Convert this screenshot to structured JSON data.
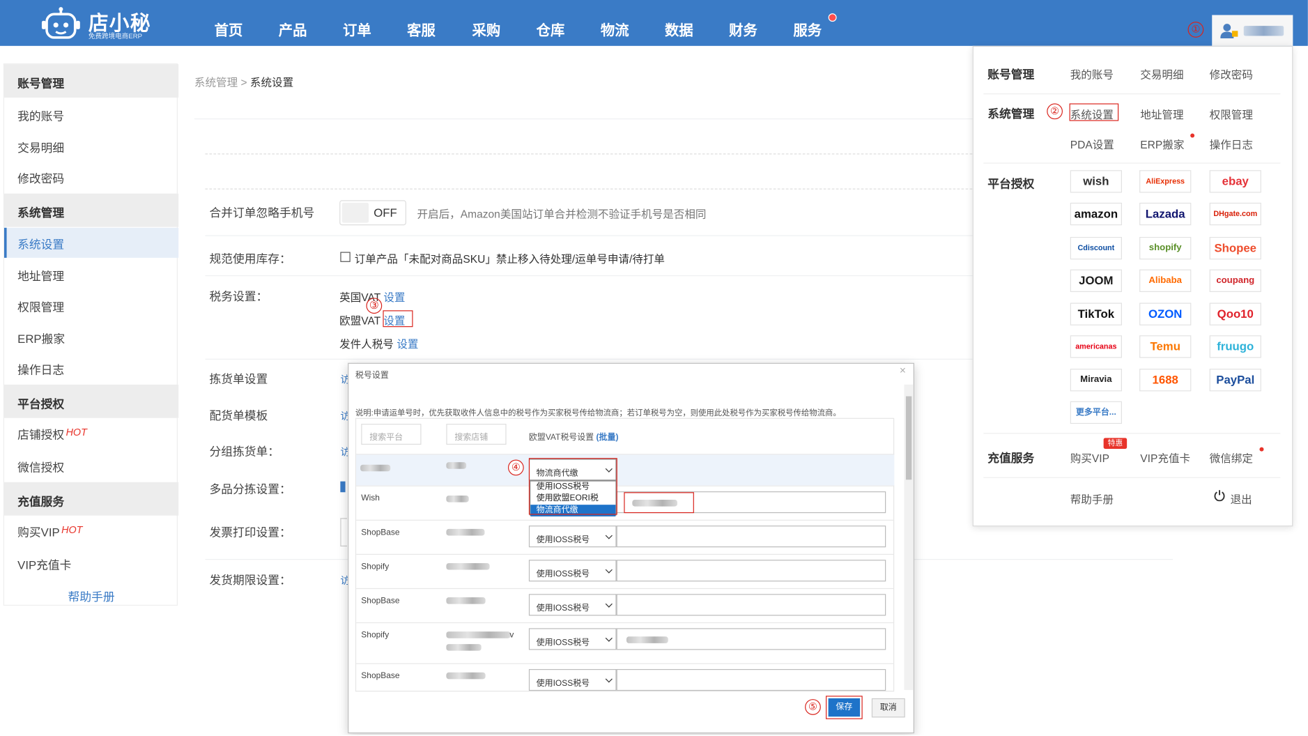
{
  "app": {
    "name": "店小秘",
    "tagline": "免费跨境电商ERP"
  },
  "nav": {
    "items": [
      "首页",
      "产品",
      "订单",
      "客服",
      "采购",
      "仓库",
      "物流",
      "数据",
      "财务",
      "服务"
    ]
  },
  "steps": [
    "①",
    "②",
    "③",
    "④",
    "⑤"
  ],
  "sidebar": {
    "sections": [
      {
        "title": "账号管理",
        "items": [
          "我的账号",
          "交易明细",
          "修改密码"
        ]
      },
      {
        "title": "系统管理",
        "items": [
          "系统设置",
          "地址管理",
          "权限管理",
          "ERP搬家",
          "操作日志"
        ]
      },
      {
        "title": "平台授权",
        "items": [
          "店铺授权",
          "微信授权"
        ]
      },
      {
        "title": "充值服务",
        "items": [
          "购买VIP",
          "VIP充值卡"
        ]
      }
    ],
    "hot": "HOT",
    "help": "帮助手册"
  },
  "breadcrumb": {
    "parent": "系统管理",
    "sep": ">",
    "current": "系统设置"
  },
  "settings": {
    "merge_label": "合并订单忽略手机号",
    "toggle": "OFF",
    "merge_hint": "开启后，Amazon美国站订单合并检测不验证手机号是否相同",
    "stock_label": "规范使用库存：",
    "stock_option": "订单产品「未配对商品SKU」禁止移入待处理/运单号申请/待打单",
    "tax_label": "税务设置：",
    "tax_uk": "英国VAT",
    "tax_eu": "欧盟VAT",
    "tax_sender": "发件人税号",
    "set_link": "设置",
    "picking_label": "拣货单设置",
    "packing_label": "配货单模板",
    "group_label": "分组拣货单：",
    "multi_label": "多品分拣设置：",
    "invoice_label": "发票打印设置：",
    "ship_deadline_label": "发货期限设置：",
    "stub_link": "访"
  },
  "account_menu": {
    "account": {
      "title": "账号管理",
      "items": [
        "我的账号",
        "交易明细",
        "修改密码"
      ]
    },
    "system": {
      "title": "系统管理",
      "items": [
        "系统设置",
        "地址管理",
        "权限管理",
        "PDA设置",
        "ERP搬家",
        "操作日志"
      ]
    },
    "platform": {
      "title": "平台授权",
      "more": "更多平台..."
    },
    "platforms": [
      {
        "name": "wish",
        "color": "#2f2f2f"
      },
      {
        "name": "AliExpress",
        "color": "#e62e04"
      },
      {
        "name": "ebay",
        "color": "#e53238"
      },
      {
        "name": "amazon",
        "color": "#111111"
      },
      {
        "name": "Lazada",
        "color": "#10156f"
      },
      {
        "name": "DHgate.com",
        "color": "#d81e06"
      },
      {
        "name": "Cdiscount",
        "color": "#0c4da2"
      },
      {
        "name": "shopify",
        "color": "#5a8f28"
      },
      {
        "name": "Shopee",
        "color": "#ee4d2d"
      },
      {
        "name": "JOOM",
        "color": "#1b1b1b"
      },
      {
        "name": "Alibaba",
        "color": "#ff6a00"
      },
      {
        "name": "coupang",
        "color": "#d0262b"
      },
      {
        "name": "TikTok",
        "color": "#111111"
      },
      {
        "name": "OZON",
        "color": "#005bff"
      },
      {
        "name": "Qoo10",
        "color": "#e0212a"
      },
      {
        "name": "americanas",
        "color": "#e60014"
      },
      {
        "name": "Temu",
        "color": "#fb7701"
      },
      {
        "name": "fruugo",
        "color": "#2db2d9"
      },
      {
        "name": "Miravia",
        "color": "#222222"
      },
      {
        "name": "1688",
        "color": "#ff5500"
      },
      {
        "name": "PayPal",
        "color": "#1b4d9c"
      }
    ],
    "recharge": {
      "title": "充值服务",
      "items": [
        "购买VIP",
        "VIP充值卡",
        "微信绑定"
      ],
      "badge": "特惠"
    },
    "help": "帮助手册",
    "logout": "退出"
  },
  "modal": {
    "title": "税号设置",
    "close": "×",
    "note": "说明:申请运单号时，优先获取收件人信息中的税号作为买家税号传给物流商；若订单税号为空，则使用此处税号作为买家税号传给物流商。",
    "search_platform": "搜索平台",
    "search_store": "搜索店铺",
    "col_header": "欧盟VAT税号设置",
    "batch": "(批量)",
    "rows": [
      {
        "platform": "",
        "option": "物流商代缴"
      },
      {
        "platform": "Wish",
        "option": ""
      },
      {
        "platform": "ShopBase",
        "option": "使用IOSS税号"
      },
      {
        "platform": "Shopify",
        "option": "使用IOSS税号"
      },
      {
        "platform": "ShopBase",
        "option": "使用IOSS税号"
      },
      {
        "platform": "Shopify",
        "option": "使用IOSS税号"
      },
      {
        "platform": "ShopBase",
        "option": "使用IOSS税号"
      }
    ],
    "options": [
      "使用IOSS税号",
      "使用欧盟EORI税",
      "物流商代缴"
    ],
    "shopify_suffix": "v",
    "save": "保存",
    "cancel": "取消"
  }
}
